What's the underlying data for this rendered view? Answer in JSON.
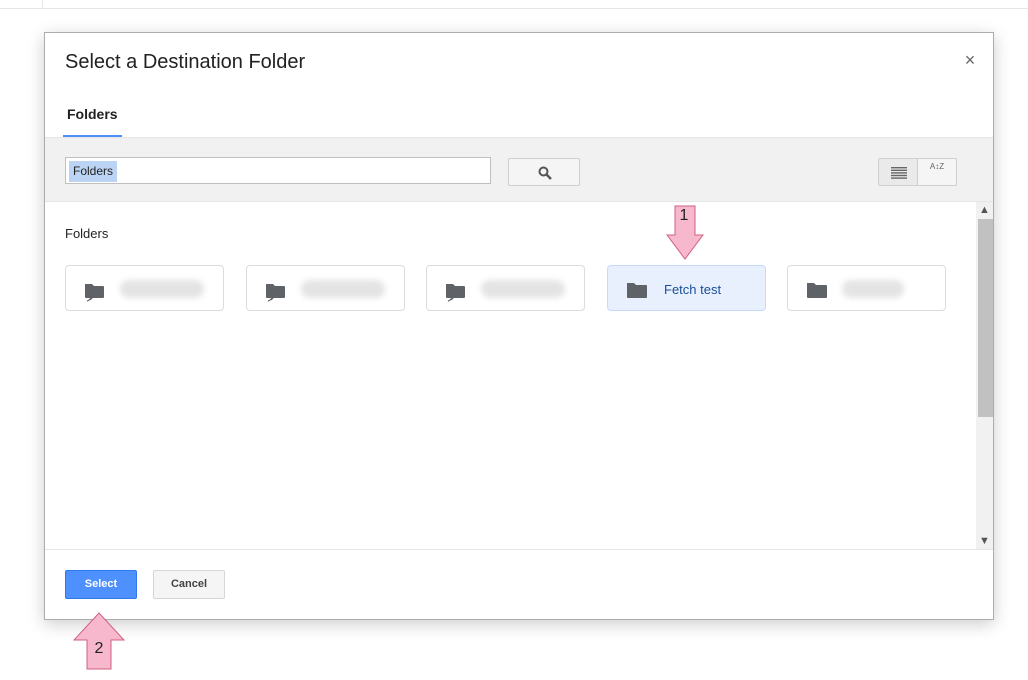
{
  "dialog": {
    "title": "Select a Destination Folder",
    "close_glyph": "×"
  },
  "tabs": [
    {
      "label": "Folders",
      "active": true
    }
  ],
  "toolbar": {
    "search_chip": "Folders",
    "search_icon": "search-icon",
    "view_icon": "list-view-icon",
    "sort_icon": "sort-az-icon",
    "sort_glyph": "A↕Z"
  },
  "content": {
    "section_label": "Folders",
    "folders": [
      {
        "name": "",
        "icon": "shared-folder-icon",
        "obscured": true,
        "selected": false
      },
      {
        "name": "",
        "icon": "shared-folder-icon",
        "obscured": true,
        "selected": false
      },
      {
        "name": "",
        "icon": "shared-folder-icon",
        "obscured": true,
        "selected": false
      },
      {
        "name": "Fetch test",
        "icon": "folder-icon",
        "obscured": false,
        "selected": true
      },
      {
        "name": "",
        "icon": "folder-icon",
        "obscured": true,
        "selected": false
      }
    ]
  },
  "footer": {
    "select_label": "Select",
    "cancel_label": "Cancel"
  },
  "annotations": [
    {
      "label": "1",
      "direction": "down",
      "color": "#f7b8cd"
    },
    {
      "label": "2",
      "direction": "up",
      "color": "#f7b8cd"
    }
  ],
  "colors": {
    "accent": "#4d90fe",
    "selected_bg": "#e8f0fe",
    "annotation": "#f7b8cd"
  }
}
